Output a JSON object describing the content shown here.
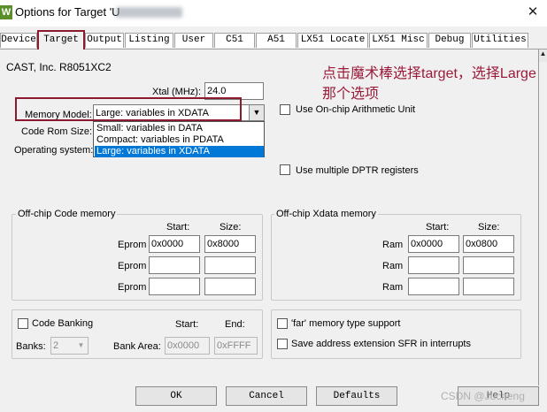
{
  "window": {
    "title": "Options for Target 'U",
    "app_icon": "W"
  },
  "tabs": [
    "Device",
    "Target",
    "Output",
    "Listing",
    "User",
    "C51",
    "A51",
    "LX51 Locate",
    "LX51 Misc",
    "Debug",
    "Utilities"
  ],
  "device_name": "CAST, Inc. R8051XC2",
  "xtal": {
    "label": "Xtal (MHz):",
    "value": "24.0"
  },
  "memory_model": {
    "label": "Memory Model:",
    "selected": "Large: variables in XDATA",
    "options": [
      "Small: variables in DATA",
      "Compact: variables in PDATA",
      "Large: variables in XDATA"
    ]
  },
  "code_rom_label": "Code Rom Size:",
  "operating_system_label": "Operating system:",
  "on_chip_arith": "Use On-chip Arithmetic Unit",
  "multiple_dptr": "Use multiple DPTR registers",
  "annotation": "点击魔术棒选择target，选择Large那个选项",
  "code_memory": {
    "title": "Off-chip Code memory",
    "start_header": "Start:",
    "size_header": "Size:",
    "rows": [
      {
        "label": "Eprom",
        "start": "0x0000",
        "size": "0x8000"
      },
      {
        "label": "Eprom",
        "start": "",
        "size": ""
      },
      {
        "label": "Eprom",
        "start": "",
        "size": ""
      }
    ]
  },
  "xdata_memory": {
    "title": "Off-chip Xdata memory",
    "start_header": "Start:",
    "size_header": "Size:",
    "rows": [
      {
        "label": "Ram",
        "start": "0x0000",
        "size": "0x0800"
      },
      {
        "label": "Ram",
        "start": "",
        "size": ""
      },
      {
        "label": "Ram",
        "start": "",
        "size": ""
      }
    ]
  },
  "code_banking": {
    "label": "Code Banking",
    "start_header": "Start:",
    "end_header": "End:",
    "banks_label": "Banks:",
    "banks_value": "2",
    "bank_area_label": "Bank Area:",
    "bank_start": "0x0000",
    "bank_end": "0xFFFF"
  },
  "far_memory": "'far' memory type support",
  "save_address": "Save address extension SFR in interrupts",
  "buttons": {
    "ok": "OK",
    "cancel": "Cancel",
    "defaults": "Defaults",
    "help": "Help"
  },
  "watermark": "CSDN @Jucheng",
  "colors": {
    "highlight": "#8b1a2e",
    "annotation": "#9b1b3a",
    "selection": "#0078d7"
  },
  "icons": {
    "close": "close-icon",
    "dropdown": "chevron-down-icon"
  }
}
